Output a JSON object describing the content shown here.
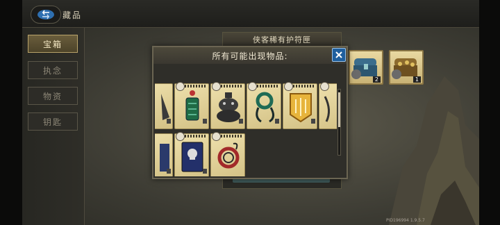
{
  "header": {
    "title": "藏品"
  },
  "sidebar": {
    "tabs": [
      {
        "label": "宝箱",
        "active": true
      },
      {
        "label": "执念",
        "active": false
      },
      {
        "label": "物资",
        "active": false
      },
      {
        "label": "钥匙",
        "active": false
      }
    ]
  },
  "background_panel": {
    "title": "侠客稀有护符匣"
  },
  "chest_slots": [
    {
      "icon": "blue-chest-icon",
      "count": "2"
    },
    {
      "icon": "gold-chest-icon",
      "count": "1"
    }
  ],
  "popup": {
    "title": "所有可能出现物品:",
    "items": [
      {
        "icon": "partial-item-icon"
      },
      {
        "icon": "green-tassel-charm-icon"
      },
      {
        "icon": "toad-figure-icon"
      },
      {
        "icon": "jade-ring-pendant-icon"
      },
      {
        "icon": "gold-shield-card-icon"
      },
      {
        "icon": "partial-scroll-icon"
      },
      {
        "icon": "partial-book-icon"
      },
      {
        "icon": "skull-book-icon"
      },
      {
        "icon": "red-ring-charm-icon"
      }
    ]
  },
  "footer": {
    "pid": "PID196994  1.9.5.7"
  },
  "colors": {
    "active_tab": "#6a5d3c",
    "close_button": "#1f5f9e",
    "card_bg": "#e6d69c"
  }
}
